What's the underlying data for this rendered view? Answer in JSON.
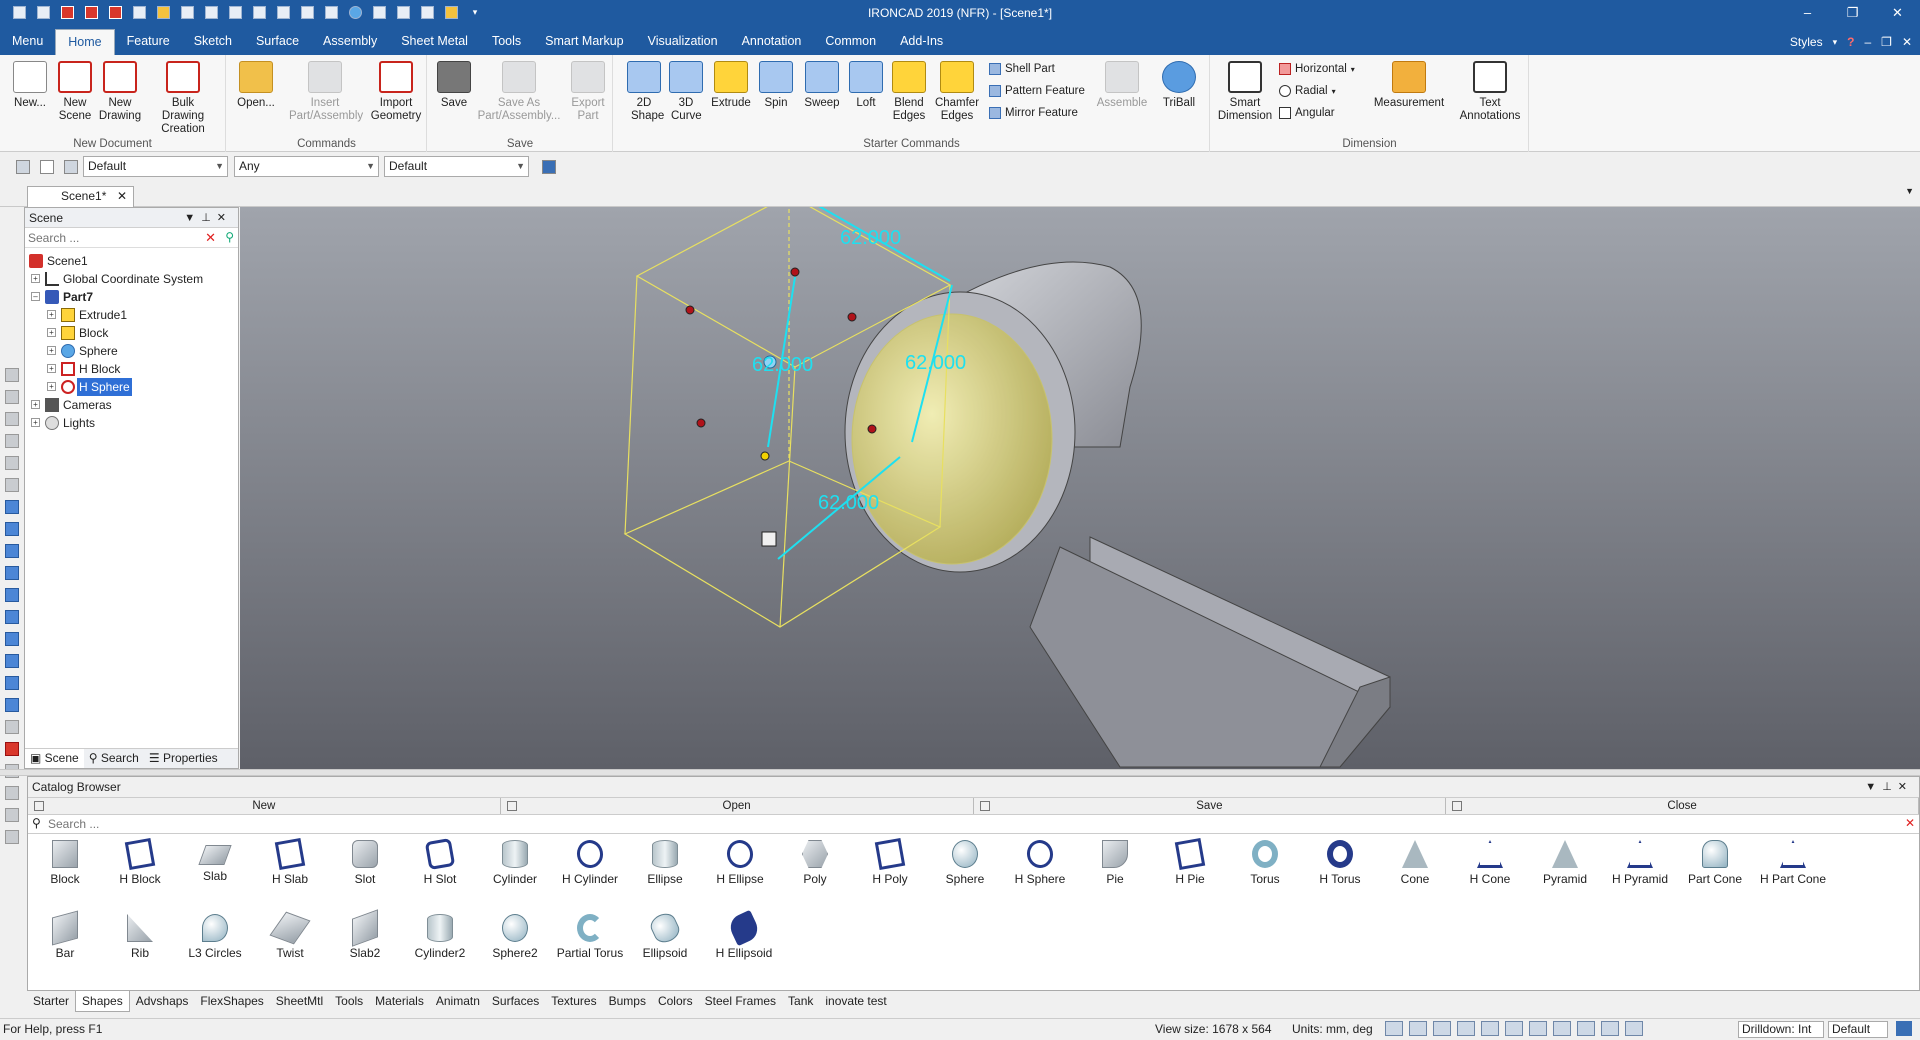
{
  "title": "IRONCAD 2019 (NFR) - [Scene1*]",
  "window_controls": [
    "–",
    "❐",
    "✕"
  ],
  "menu": {
    "tabs": [
      "Menu",
      "Home",
      "Feature",
      "Sketch",
      "Surface",
      "Assembly",
      "Sheet Metal",
      "Tools",
      "Smart Markup",
      "Visualization",
      "Annotation",
      "Common",
      "Add-Ins"
    ],
    "active": "Home",
    "styles_label": "Styles"
  },
  "ribbon": {
    "new_document": {
      "label": "New Document",
      "buttons": [
        "New...",
        "New Scene",
        "New Drawing",
        "Bulk Drawing Creation"
      ]
    },
    "commands": {
      "label": "Commands",
      "buttons": [
        "Open...",
        "Insert Part/Assembly",
        "Import Geometry"
      ]
    },
    "save": {
      "label": "Save",
      "buttons": [
        "Save",
        "Save As Part/Assembly...",
        "Export Part"
      ]
    },
    "starter": {
      "label": "Starter Commands",
      "buttons": [
        "2D Shape",
        "3D Curve",
        "Extrude",
        "Spin",
        "Sweep",
        "Loft",
        "Blend Edges",
        "Chamfer Edges"
      ],
      "small": [
        "Shell Part",
        "Pattern Feature",
        "Mirror Feature"
      ],
      "more": [
        "Assemble",
        "TriBall"
      ]
    },
    "dimension": {
      "label": "Dimension",
      "buttons": [
        "Smart Dimension",
        "Measurement",
        "Text Annotations"
      ],
      "small": [
        "Horizontal",
        "Radial",
        "Angular"
      ]
    }
  },
  "toolbar2": {
    "combo1": "Default",
    "combo2": "Any",
    "combo3": "Default"
  },
  "doc_tab": "Scene1*",
  "scene_panel": {
    "title": "Scene",
    "search_placeholder": "Search ...",
    "tree": {
      "scene1": "Scene1",
      "gcs": "Global Coordinate System",
      "part7": "Part7",
      "extrude1": "Extrude1",
      "block": "Block",
      "sphere": "Sphere",
      "hblock": "H Block",
      "hsphere": "H Sphere",
      "cameras": "Cameras",
      "lights": "Lights"
    },
    "tabs": [
      "Scene",
      "Search",
      "Properties"
    ]
  },
  "viewport": {
    "dimensions": [
      "62.000",
      "62.000",
      "62.000",
      "62.000"
    ],
    "colors": {
      "bg_top": "#9ea2aa",
      "bg_bottom": "#5e6068",
      "dim": "#1ee0f0",
      "sphere": "#e8e49a",
      "box": "#e8e060"
    }
  },
  "catalog": {
    "title": "Catalog Browser",
    "buttons": [
      "New",
      "Open",
      "Save",
      "Close"
    ],
    "search_placeholder": "Search ...",
    "row1": [
      "Block",
      "H Block",
      "Slab",
      "H Slab",
      "Slot",
      "H Slot",
      "Cylinder",
      "H Cylinder",
      "Ellipse",
      "H Ellipse",
      "Poly",
      "H Poly",
      "Sphere",
      "H Sphere",
      "Pie",
      "H Pie",
      "Torus",
      "H Torus",
      "Cone",
      "H Cone",
      "Pyramid",
      "H Pyramid",
      "Part Cone",
      "H Part Cone"
    ],
    "row2": [
      "Bar",
      "Rib",
      "L3 Circles",
      "Twist",
      "Slab2",
      "Cylinder2",
      "Sphere2",
      "Partial Torus",
      "Ellipsoid",
      "H Ellipsoid"
    ],
    "bottom_tabs": [
      "Starter",
      "Shapes",
      "Advshaps",
      "FlexShapes",
      "SheetMtl",
      "Tools",
      "Materials",
      "Animatn",
      "Surfaces",
      "Textures",
      "Bumps",
      "Colors",
      "Steel Frames",
      "Tank",
      "inovate test"
    ],
    "active_tab": "Shapes"
  },
  "status": {
    "help": "For Help, press F1",
    "view_size": "View size: 1678 x  564",
    "units": "Units: mm, deg",
    "drilldown": "Drilldown: Int",
    "default": "Default"
  }
}
